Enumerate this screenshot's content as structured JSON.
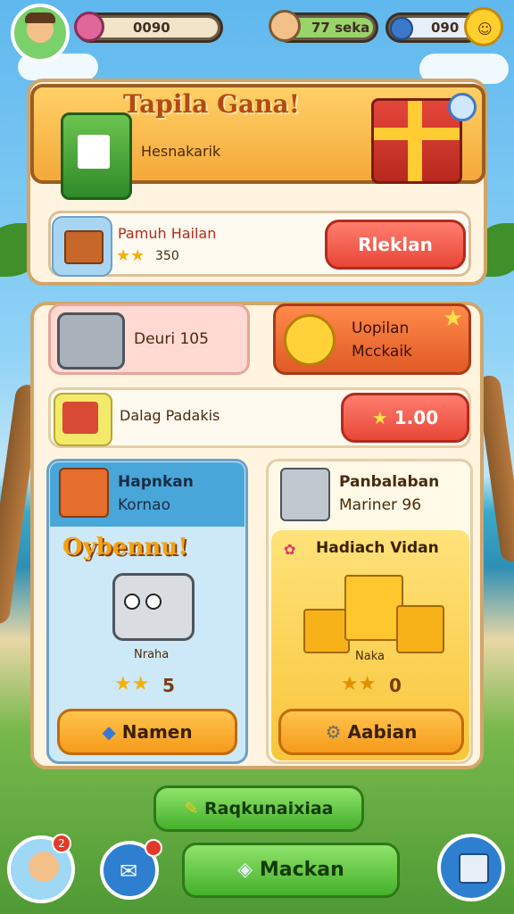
{
  "top_bar": {
    "coins": "0090",
    "friends": "77 seka",
    "gems": "090"
  },
  "banner": {
    "title": "Tapila Gana!",
    "subtitle": "Hesnakarik"
  },
  "featured": {
    "name": "Pamuh Hailan",
    "rating": "350",
    "button": "Rleklan"
  },
  "row1": {
    "left_label": "Deuri 105",
    "right_label_1": "Uopilan",
    "right_label_2": "Mcckaik"
  },
  "daily": {
    "label": "Dalag Padakis",
    "price": "1.00"
  },
  "offer_left": {
    "title": "Hapnkan",
    "subtitle": "Kornao",
    "burst": "Oybennu!",
    "item": "Nraha",
    "stars": "5",
    "button": "Namen"
  },
  "offer_right": {
    "title": "Panbalaban",
    "subtitle": "Mariner 96",
    "heading": "Hadiach Vidan",
    "item": "Naka",
    "stars": "0",
    "button": "Aabian"
  },
  "bottom": {
    "primary": "Raqkunaixiaa",
    "secondary": "Mackan",
    "badge_left": "2"
  },
  "colors": {
    "accent_red": "#e84737",
    "accent_orange": "#f59a1a",
    "accent_green": "#45b02c",
    "panel_cream": "#fff4df"
  }
}
